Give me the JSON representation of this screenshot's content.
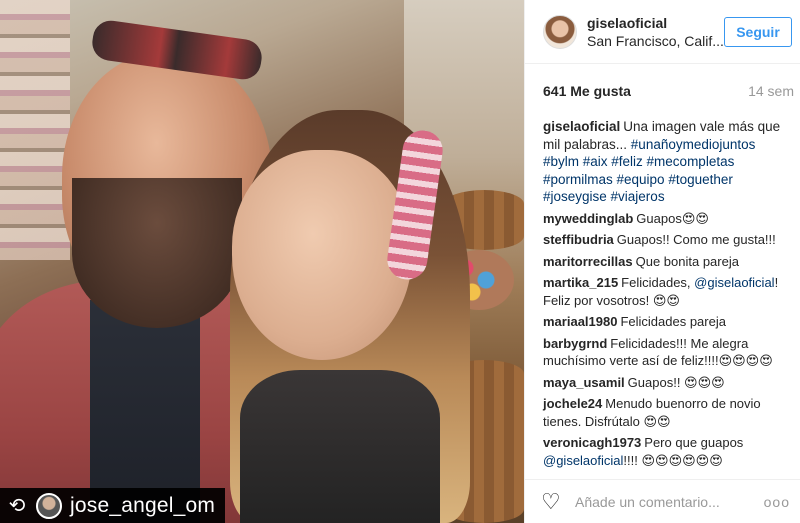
{
  "post": {
    "repost_username": "jose_angel_om"
  },
  "header": {
    "username": "giselaoficial",
    "location": "San Francisco, Calif...",
    "follow_label": "Seguir"
  },
  "stats": {
    "likes": "641 Me gusta",
    "age": "14 sem"
  },
  "caption": {
    "user": "giselaoficial",
    "text": "Una imagen vale más que mil palabras... ",
    "hashtags": "#unañoymediojuntos #bylm #aix #feliz #mecompletas #pormilmas #equipo #toguether #joseygise #viajeros"
  },
  "comments": [
    {
      "user": "myweddinglab",
      "text": "Guapos",
      "emoji": "😍😍"
    },
    {
      "user": "steffibudria",
      "text": "Guapos!! Como me gusta!!!",
      "emoji": ""
    },
    {
      "user": "maritorrecillas",
      "text": "Que bonita pareja",
      "emoji": ""
    },
    {
      "user": "martika_215",
      "text": "Felicidades, ",
      "mention": "@giselaoficial",
      "after": "! Feliz por vosotros! ",
      "emoji": "😍😍"
    },
    {
      "user": "mariaal1980",
      "text": "Felicidades pareja",
      "emoji": ""
    },
    {
      "user": "barbygrnd",
      "text": "Felicidades!!! Me alegra muchísimo verte así de feliz!!!!",
      "emoji": "😍😍😍😍"
    },
    {
      "user": "maya_usamil",
      "text": "Guapos!! ",
      "emoji": "😍😍😍"
    },
    {
      "user": "jochele24",
      "text": "Menudo buenorro de novio tienes. Disfrútalo ",
      "emoji": "😍😍"
    },
    {
      "user": "veronicagh1973",
      "text": "Pero que guapos ",
      "mention": "@giselaoficial",
      "after": "!!!! ",
      "emoji": "😍😍😍😍😍😍"
    }
  ],
  "footer": {
    "placeholder": "Añade un comentario...",
    "more": "ooo"
  },
  "icons": {
    "repost": "repost-icon",
    "heart": "heart-icon",
    "more": "more-options-icon"
  },
  "colors": {
    "follow_blue": "#3897f0",
    "link_blue": "#003569",
    "meta_gray": "#999999"
  }
}
